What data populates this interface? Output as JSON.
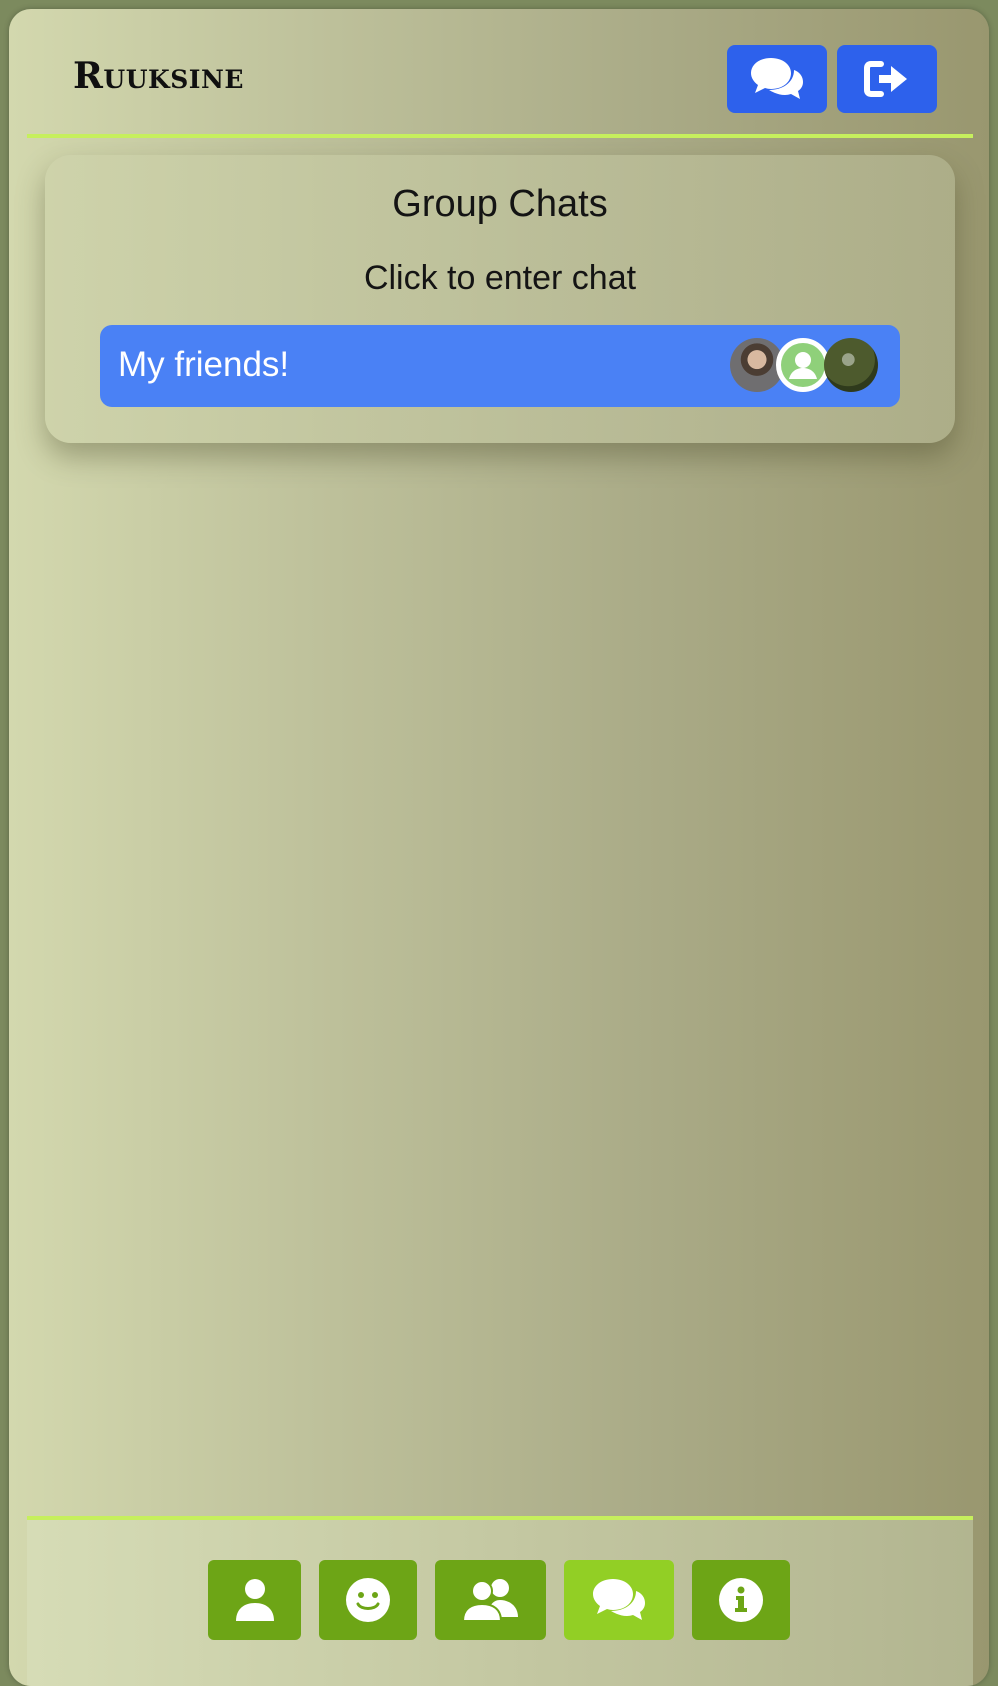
{
  "header": {
    "brand": "Ruuksine",
    "buttons": [
      {
        "name": "chat",
        "icon": "chat-bubbles-icon"
      },
      {
        "name": "logout",
        "icon": "sign-out-icon"
      }
    ]
  },
  "main": {
    "title": "Group Chats",
    "subtitle": "Click to enter chat",
    "groups": [
      {
        "name": "My friends!",
        "avatars": [
          "member-photo-1",
          "default-user-avatar",
          "member-photo-3"
        ]
      }
    ]
  },
  "footer": {
    "nav": [
      {
        "name": "profile",
        "icon": "user-icon"
      },
      {
        "name": "emoji",
        "icon": "smile-icon"
      },
      {
        "name": "friends",
        "icon": "users-icon"
      },
      {
        "name": "group-chats",
        "icon": "chat-bubbles-icon",
        "active": true
      },
      {
        "name": "info",
        "icon": "info-icon"
      }
    ]
  },
  "colors": {
    "header_button": "#2d61ec",
    "group_row": "#4a81f5",
    "nav_button": "#6da516",
    "nav_button_active": "#92cf25",
    "divider": "#c6ef5d"
  }
}
